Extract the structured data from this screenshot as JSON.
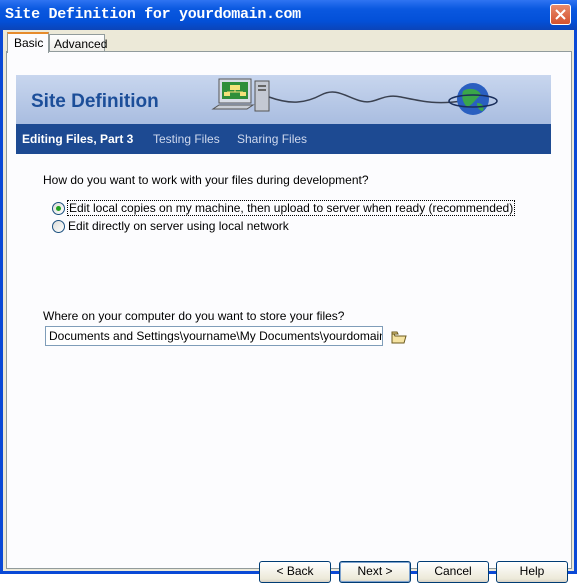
{
  "window": {
    "title": "Site Definition for yourdomain.com"
  },
  "tabs": [
    {
      "label": "Basic"
    },
    {
      "label": "Advanced"
    }
  ],
  "banner": {
    "title": "Site Definition"
  },
  "steps": [
    {
      "label": "Editing Files, Part 3",
      "active": true
    },
    {
      "label": "Testing Files"
    },
    {
      "label": "Sharing Files"
    }
  ],
  "question1": "How do you want to work with your files during development?",
  "options": [
    {
      "label": "Edit local copies on my machine, then upload to server when ready (recommended)",
      "selected": true
    },
    {
      "label": "Edit directly on server using local network",
      "selected": false
    }
  ],
  "question2": "Where on your computer do you want to store your files?",
  "path_value": "Documents and Settings\\yourname\\My Documents\\yourdomain.com\\",
  "buttons": {
    "back": "< Back",
    "next": "Next >",
    "cancel": "Cancel",
    "help": "Help"
  },
  "colors": {
    "titlebar": "#0a58e0",
    "nav_background": "#1d4a92",
    "banner_title": "#1c4e99"
  }
}
